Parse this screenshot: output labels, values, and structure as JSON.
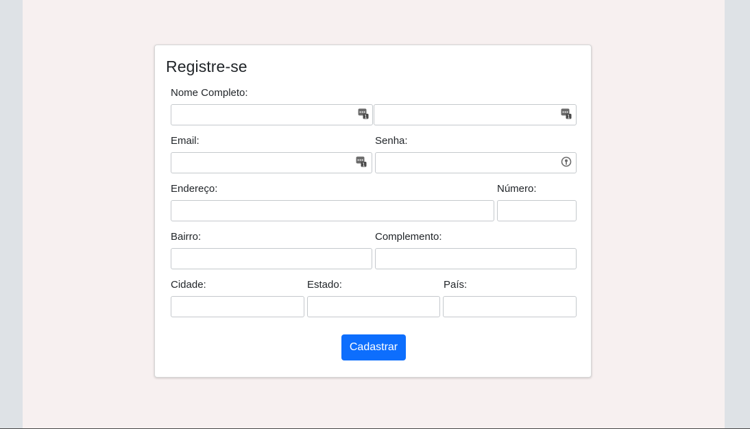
{
  "form": {
    "title": "Registre-se",
    "submit_label": "Cadastrar",
    "labels": {
      "nome_completo": "Nome Completo:",
      "email": "Email:",
      "senha": "Senha:",
      "endereco": "Endereço:",
      "numero": "Número:",
      "bairro": "Bairro:",
      "complemento": "Complemento:",
      "cidade": "Cidade:",
      "estado": "Estado:",
      "pais": "País:"
    },
    "values": {
      "nome": "",
      "sobrenome": "",
      "email": "",
      "senha": "",
      "endereco": "",
      "numero": "",
      "bairro": "",
      "complemento": "",
      "cidade": "",
      "estado": "",
      "pais": ""
    },
    "icons": {
      "autofill": "password-manager-icon",
      "password": "key-icon"
    }
  },
  "colors": {
    "page_background": "#f7f0f0",
    "outer_background": "#dee2e6",
    "accent": "#0d6efd"
  }
}
